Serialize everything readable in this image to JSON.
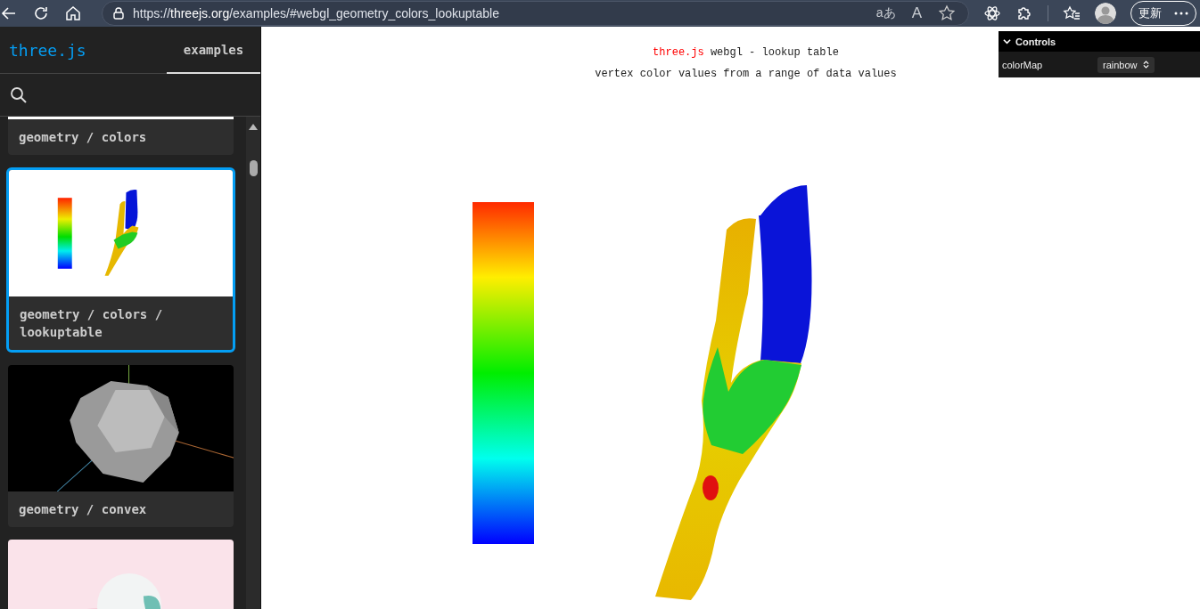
{
  "browser": {
    "url": "https://**threejs.org**/examples/#webgl_geometry_colors_lookuptable",
    "translate_label": "aあ",
    "read_aloud_label": "A",
    "update_button": "更新"
  },
  "sidebar": {
    "logo": "three.js",
    "tab": {
      "label": "examples",
      "selected": true
    },
    "examples": [
      {
        "label": "geometry / colors",
        "selected": false
      },
      {
        "label": "geometry / colors / lookuptable",
        "selected": true
      },
      {
        "label": "geometry / convex",
        "selected": false
      },
      {
        "selected": false
      }
    ]
  },
  "main": {
    "title_link": "three.js",
    "title": "webgl - lookup table",
    "subtitle": "vertex color values from a range of data values"
  },
  "controls": {
    "title": "Controls",
    "expanded": true,
    "rows": [
      {
        "label": "colorMap",
        "value": "rainbow"
      }
    ]
  }
}
